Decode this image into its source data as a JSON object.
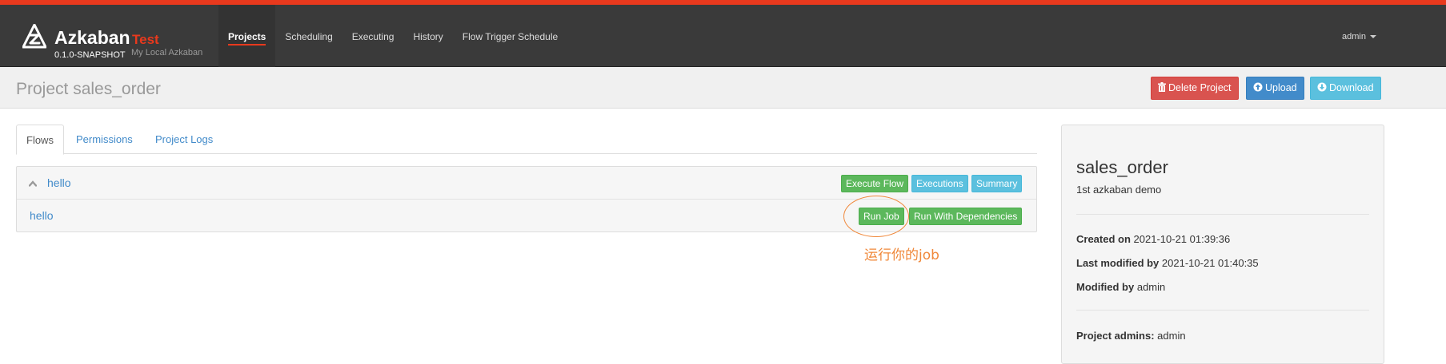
{
  "brand": {
    "name": "Azkaban",
    "env": "Test",
    "version": "0.1.0-SNAPSHOT",
    "subtitle": "My Local Azkaban",
    "accent_color": "#e8391d"
  },
  "nav": {
    "items": [
      {
        "label": "Projects",
        "active": true
      },
      {
        "label": "Scheduling"
      },
      {
        "label": "Executing"
      },
      {
        "label": "History"
      },
      {
        "label": "Flow Trigger Schedule"
      }
    ],
    "user": "admin"
  },
  "header": {
    "title": "Project sales_order",
    "buttons": {
      "delete": "Delete Project",
      "upload": "Upload",
      "download": "Download"
    }
  },
  "tabs": [
    {
      "label": "Flows",
      "active": true
    },
    {
      "label": "Permissions"
    },
    {
      "label": "Project Logs"
    }
  ],
  "flow": {
    "name": "hello",
    "buttons": {
      "execute": "Execute Flow",
      "executions": "Executions",
      "summary": "Summary"
    },
    "jobs": [
      {
        "name": "hello",
        "run_job": "Run Job",
        "run_deps": "Run With Dependencies"
      }
    ]
  },
  "annotation": {
    "text": "运行你的job",
    "color": "#f0883a"
  },
  "project": {
    "name": "sales_order",
    "description": "1st azkaban demo",
    "created_on_label": "Created on",
    "created_on": "2021-10-21 01:39:36",
    "last_modified_label": "Last modified by",
    "last_modified": "2021-10-21 01:40:35",
    "modified_by_label": "Modified by",
    "modified_by": "admin",
    "admins_label": "Project admins:",
    "admins": "admin"
  }
}
